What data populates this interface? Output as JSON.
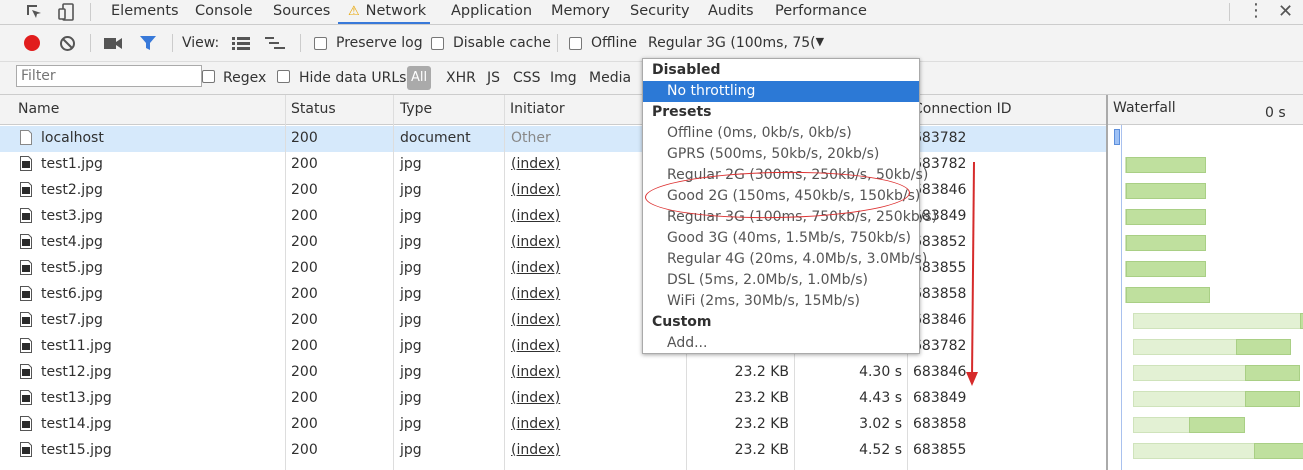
{
  "tabs": [
    "Elements",
    "Console",
    "Sources",
    "Network",
    "Application",
    "Memory",
    "Security",
    "Audits",
    "Performance"
  ],
  "toolbar": {
    "view_label": "View:",
    "preserve_log": "Preserve log",
    "disable_cache": "Disable cache",
    "offline": "Offline",
    "throttle_value": "Regular 3G (100ms, 75("
  },
  "filter": {
    "placeholder": "Filter",
    "regex": "Regex",
    "hide_data_urls": "Hide data URLs",
    "all": "All",
    "types": [
      "XHR",
      "JS",
      "CSS",
      "Img",
      "Media"
    ]
  },
  "columns": {
    "name": "Name",
    "status": "Status",
    "type": "Type",
    "initiator": "Initiator",
    "connection": "Connection ID",
    "waterfall": "Waterfall",
    "time_tick": "0 s"
  },
  "rows": [
    {
      "name": "localhost",
      "status": "200",
      "type": "document",
      "initiator": "Other",
      "size": "",
      "time": "",
      "conn": "683782",
      "wf": null
    },
    {
      "name": "test1.jpg",
      "status": "200",
      "type": "jpg",
      "initiator": "(index)",
      "size": "",
      "time": "",
      "conn": "683782",
      "wf": [
        0.04,
        0.0,
        0.43
      ]
    },
    {
      "name": "test2.jpg",
      "status": "200",
      "type": "jpg",
      "initiator": "(index)",
      "size": "",
      "time": "",
      "conn": "683846",
      "wf": [
        0.04,
        0.0,
        0.43
      ]
    },
    {
      "name": "test3.jpg",
      "status": "200",
      "type": "jpg",
      "initiator": "(index)",
      "size": "",
      "time": "",
      "conn": "683849",
      "wf": [
        0.04,
        0.0,
        0.43
      ]
    },
    {
      "name": "test4.jpg",
      "status": "200",
      "type": "jpg",
      "initiator": "(index)",
      "size": "",
      "time": "",
      "conn": "683852",
      "wf": [
        0.04,
        0.0,
        0.43
      ]
    },
    {
      "name": "test5.jpg",
      "status": "200",
      "type": "jpg",
      "initiator": "(index)",
      "size": "",
      "time": "",
      "conn": "683855",
      "wf": [
        0.04,
        0.0,
        0.43
      ]
    },
    {
      "name": "test6.jpg",
      "status": "200",
      "type": "jpg",
      "initiator": "(index)",
      "size": "",
      "time": "",
      "conn": "683858",
      "wf": [
        0.04,
        0.0,
        0.45
      ]
    },
    {
      "name": "test7.jpg",
      "status": "200",
      "type": "jpg",
      "initiator": "(index)",
      "size": "",
      "time": "",
      "conn": "683846",
      "wf": [
        0.08,
        0.9,
        0.13
      ]
    },
    {
      "name": "test11.jpg",
      "status": "200",
      "type": "jpg",
      "initiator": "(index)",
      "size": "",
      "time": "",
      "conn": "683782",
      "wf": [
        0.08,
        0.55,
        0.3
      ]
    },
    {
      "name": "test12.jpg",
      "status": "200",
      "type": "jpg",
      "initiator": "(index)",
      "size": "23.2 KB",
      "time": "4.30 s",
      "conn": "683846",
      "wf": [
        0.08,
        0.6,
        0.3
      ]
    },
    {
      "name": "test13.jpg",
      "status": "200",
      "type": "jpg",
      "initiator": "(index)",
      "size": "23.2 KB",
      "time": "4.43 s",
      "conn": "683849",
      "wf": [
        0.08,
        0.6,
        0.3
      ]
    },
    {
      "name": "test14.jpg",
      "status": "200",
      "type": "jpg",
      "initiator": "(index)",
      "size": "23.2 KB",
      "time": "3.02 s",
      "conn": "683858",
      "wf": [
        0.08,
        0.3,
        0.3
      ]
    },
    {
      "name": "test15.jpg",
      "status": "200",
      "type": "jpg",
      "initiator": "(index)",
      "size": "23.2 KB",
      "time": "4.52 s",
      "conn": "683855",
      "wf": [
        0.08,
        0.65,
        0.3
      ]
    }
  ],
  "dropdown": {
    "disabled_header": "Disabled",
    "no_throttling": "No throttling",
    "presets_header": "Presets",
    "presets": [
      "Offline (0ms, 0kb/s, 0kb/s)",
      "GPRS (500ms, 50kb/s, 20kb/s)",
      "Regular 2G (300ms, 250kb/s, 50kb/s)",
      "Good 2G (150ms, 450kb/s, 150kb/s)",
      "Regular 3G (100ms, 750kb/s, 250kb/s)",
      "Good 3G (40ms, 1.5Mb/s, 750kb/s)",
      "Regular 4G (20ms, 4.0Mb/s, 3.0Mb/s)",
      "DSL (5ms, 2.0Mb/s, 1.0Mb/s)",
      "WiFi (2ms, 30Mb/s, 15Mb/s)"
    ],
    "custom_header": "Custom",
    "add": "Add..."
  },
  "colors": {
    "accent": "#3879d9",
    "record": "#e11d1d",
    "waterfall_light": "#e3f1d4",
    "waterfall_dark": "#bfe09e",
    "annotation": "#d62b2b"
  }
}
